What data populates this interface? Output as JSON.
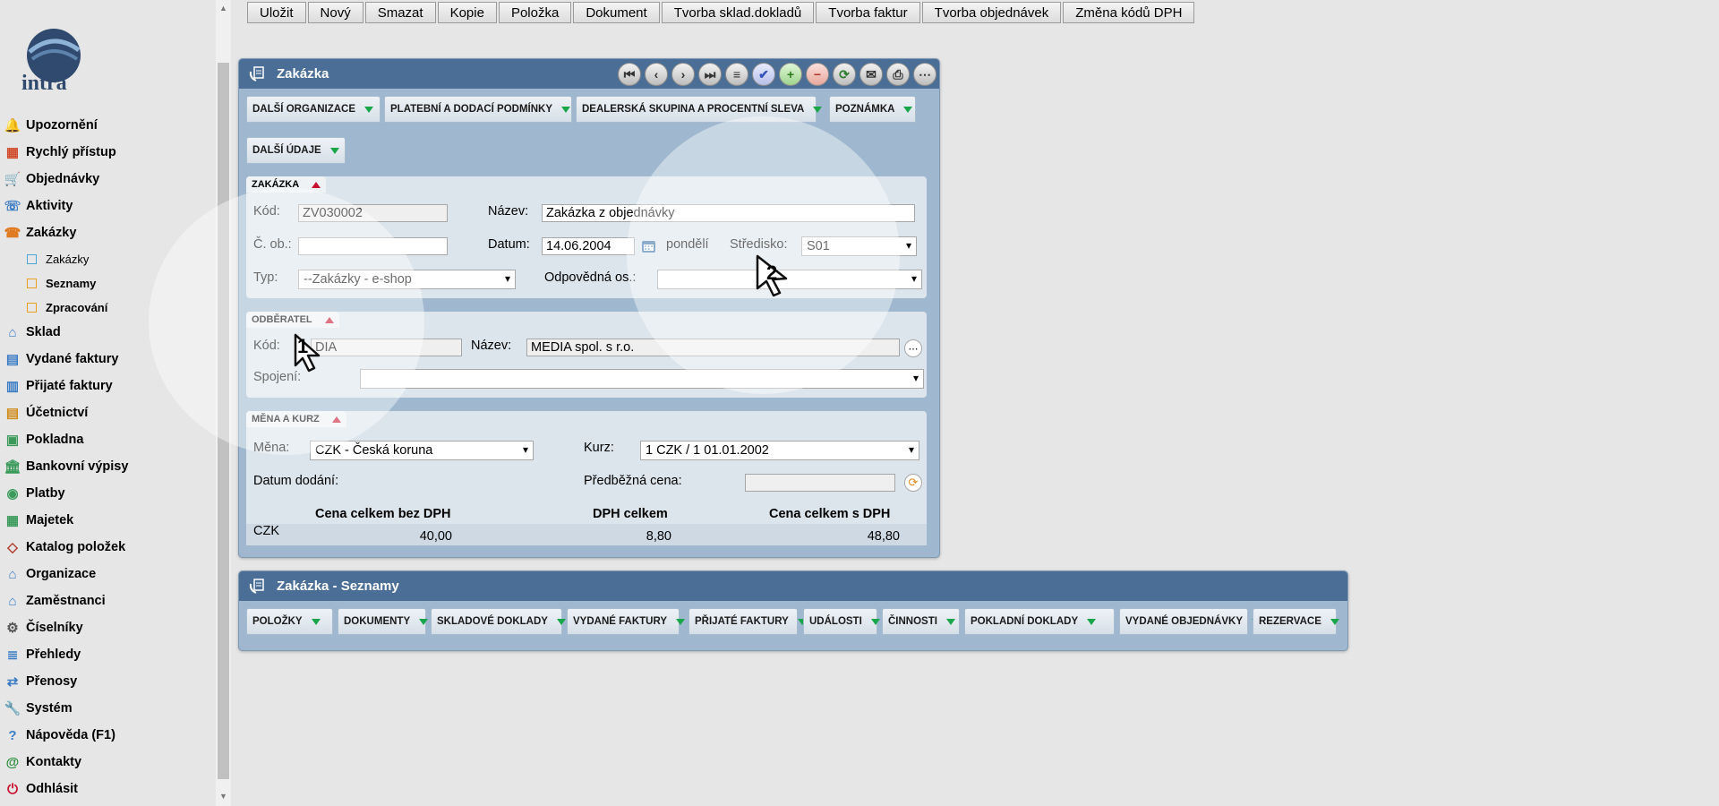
{
  "sidebar": {
    "logo_text": "intra",
    "items": [
      {
        "label": "Upozornění",
        "icon": "bell-icon"
      },
      {
        "label": "Rychlý přístup",
        "icon": "quick-access-icon"
      },
      {
        "label": "Objednávky",
        "icon": "cart-icon"
      },
      {
        "label": "Aktivity",
        "icon": "phone-icon"
      },
      {
        "label": "Zakázky",
        "icon": "phone-doc-icon"
      },
      {
        "label": "Sklad",
        "icon": "warehouse-icon"
      },
      {
        "label": "Vydané faktury",
        "icon": "invoice-out-icon"
      },
      {
        "label": "Přijaté faktury",
        "icon": "invoice-in-icon"
      },
      {
        "label": "Účetnictví",
        "icon": "ledger-icon"
      },
      {
        "label": "Pokladna",
        "icon": "cash-register-icon"
      },
      {
        "label": "Bankovní výpisy",
        "icon": "bank-icon"
      },
      {
        "label": "Platby",
        "icon": "payments-icon"
      },
      {
        "label": "Majetek",
        "icon": "asset-icon"
      },
      {
        "label": "Katalog položek",
        "icon": "tag-icon"
      },
      {
        "label": "Organizace",
        "icon": "organization-icon"
      },
      {
        "label": "Zaměstnanci",
        "icon": "employees-icon"
      },
      {
        "label": "Číselníky",
        "icon": "gear-icon"
      },
      {
        "label": "Přehledy",
        "icon": "list-icon"
      },
      {
        "label": "Přenosy",
        "icon": "transfer-icon"
      },
      {
        "label": "Systém",
        "icon": "wrench-icon"
      },
      {
        "label": "Nápověda (F1)",
        "icon": "help-icon"
      },
      {
        "label": "Kontakty",
        "icon": "at-icon"
      },
      {
        "label": "Odhlásit",
        "icon": "power-icon"
      }
    ],
    "sub_items": [
      {
        "label": "Zakázky"
      },
      {
        "label": "Seznamy"
      },
      {
        "label": "Zpracování"
      }
    ]
  },
  "toolbar": {
    "buttons": [
      "Uložit",
      "Nový",
      "Smazat",
      "Kopie",
      "Položka",
      "Dokument",
      "Tvorba sklad.dokladů",
      "Tvorba faktur",
      "Tvorba objednávek",
      "Změna kódů DPH"
    ]
  },
  "form_panel": {
    "title": "Zakázka",
    "tabs": [
      "DALŠÍ ORGANIZACE",
      "PLATEBNÍ A DODACÍ PODMÍNKY",
      "DEALERSKÁ SKUPINA A PROCENTNÍ SLEVA",
      "POZNÁMKA",
      "DALŠÍ ÚDAJE"
    ],
    "zakazka": {
      "title": "ZAKÁZKA",
      "kod_label": "Kód:",
      "kod_value": "ZV030002",
      "nazev_label": "Název:",
      "nazev_value": "Zakázka z objednávky",
      "cob_label": "Č. ob.:",
      "cob_value": "",
      "datum_label": "Datum:",
      "datum_value": "14.06.2004",
      "day_name": "pondělí",
      "stredisko_label": "Středisko:",
      "stredisko_value": "S01",
      "typ_label": "Typ:",
      "typ_value": "--Zakázky - e-shop",
      "odpovedna_label": "Odpovědná os.:",
      "odpovedna_value": ""
    },
    "odberatel": {
      "title": "ODBĚRATEL",
      "kod_label": "Kód:",
      "kod_value": "DIA",
      "nazev_label": "Název:",
      "nazev_value": "MEDIA spol. s r.o.",
      "spojeni_label": "Spojení:",
      "spojeni_value": ""
    },
    "mena": {
      "title": "MĚNA A KURZ",
      "mena_label": "Měna:",
      "mena_value": "CZK - Česká koruna",
      "kurz_label": "Kurz:",
      "kurz_value": "1 CZK / 1 01.01.2002",
      "datum_dodani_label": "Datum dodání:",
      "predbezna_label": "Předběžná cena:",
      "predbezna_value": ""
    },
    "totals": {
      "headers": [
        "Cena celkem bez DPH",
        "DPH celkem",
        "Cena celkem s DPH"
      ],
      "currency": "CZK",
      "values": [
        "40,00",
        "8,80",
        "48,80"
      ]
    }
  },
  "lists_panel": {
    "title": "Zakázka - Seznamy",
    "tabs": [
      "POLOŽKY",
      "DOKUMENTY",
      "SKLADOVÉ DOKLADY",
      "VYDANÉ FAKTURY",
      "PŘIJATÉ FAKTURY",
      "UDÁLOSTI",
      "ČINNOSTI",
      "POKLADNÍ DOKLADY",
      "VYDANÉ OBJEDNÁVKY",
      "REZERVACE"
    ]
  },
  "annotations": [
    "1",
    "2"
  ]
}
